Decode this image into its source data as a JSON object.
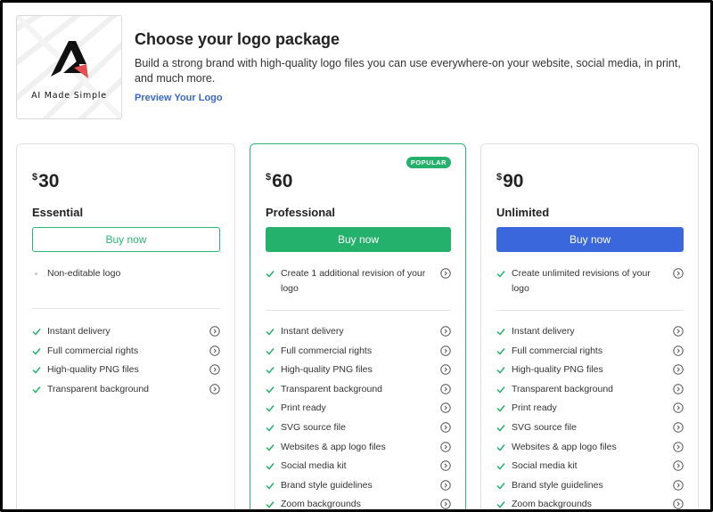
{
  "header": {
    "title": "Choose your logo package",
    "description": "Build a strong brand with high-quality logo files you can use everywhere-on your website, social media, in print, and much more.",
    "preview_link": "Preview Your Logo"
  },
  "logo": {
    "caption": "AI Made Simple",
    "icon": "letter-a-logo-icon"
  },
  "colors": {
    "accent_green": "#23b16b",
    "accent_blue": "#3b67dd",
    "link_blue": "#3a66c4"
  },
  "plans": [
    {
      "currency": "$",
      "price": "30",
      "name": "Essential",
      "button_label": "Buy now",
      "top_features": [
        "Non-editable logo"
      ],
      "features": [
        "Instant delivery",
        "Full commercial rights",
        "High-quality PNG files",
        "Transparent background"
      ]
    },
    {
      "badge": "POPULAR",
      "currency": "$",
      "price": "60",
      "name": "Professional",
      "button_label": "Buy now",
      "top_features": [
        "Create 1 additional revision of your logo"
      ],
      "features": [
        "Instant delivery",
        "Full commercial rights",
        "High-quality PNG files",
        "Transparent background",
        "Print ready",
        "SVG source file",
        "Websites & app logo files",
        "Social media kit",
        "Brand style guidelines",
        "Zoom backgrounds"
      ]
    },
    {
      "currency": "$",
      "price": "90",
      "name": "Unlimited",
      "button_label": "Buy now",
      "top_features": [
        "Create unlimited revisions of your logo"
      ],
      "features": [
        "Instant delivery",
        "Full commercial rights",
        "High-quality PNG files",
        "Transparent background",
        "Print ready",
        "SVG source file",
        "Websites & app logo files",
        "Social media kit",
        "Brand style guidelines",
        "Zoom backgrounds"
      ]
    }
  ]
}
